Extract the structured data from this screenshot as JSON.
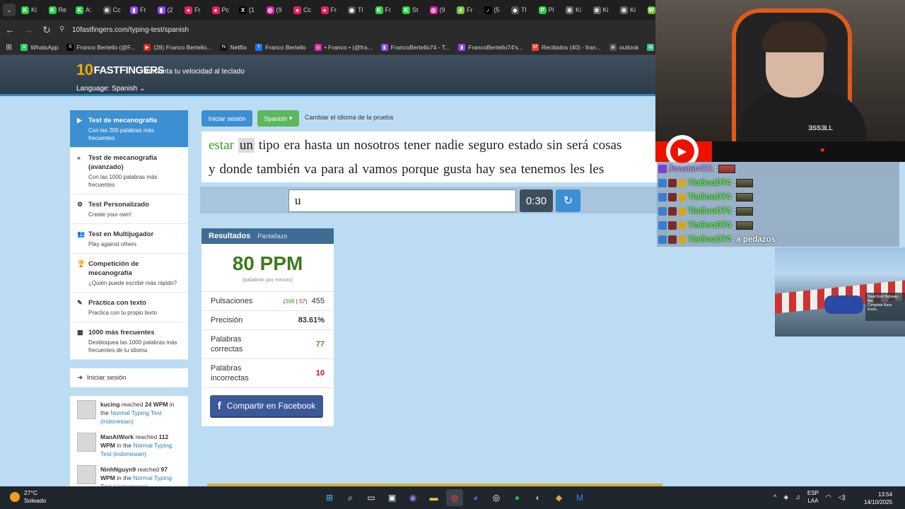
{
  "browser": {
    "tabs": [
      {
        "label": "Ki",
        "color": "#2ecc40",
        "glyph": "K"
      },
      {
        "label": "Re",
        "color": "#2ecc40",
        "glyph": "K"
      },
      {
        "label": "A:",
        "color": "#2ecc40",
        "glyph": "K"
      },
      {
        "label": "Cc",
        "color": "#555555",
        "glyph": "⊗"
      },
      {
        "label": "Fr",
        "color": "#9146ff",
        "glyph": "▮"
      },
      {
        "label": "(2",
        "color": "#9146ff",
        "glyph": "▮"
      },
      {
        "label": "Fr",
        "color": "#e91e63",
        "glyph": "●"
      },
      {
        "label": "Pc",
        "color": "#e91e63",
        "glyph": "●"
      },
      {
        "label": "(1",
        "color": "#000000",
        "glyph": "X"
      },
      {
        "label": "(9",
        "color": "#d6249f",
        "glyph": "◎"
      },
      {
        "label": "Cc",
        "color": "#e91e63",
        "glyph": "●"
      },
      {
        "label": "Fr",
        "color": "#e91e63",
        "glyph": "●"
      },
      {
        "label": "Tl",
        "color": "#555555",
        "glyph": "◉"
      },
      {
        "label": "Fr",
        "color": "#2ecc40",
        "glyph": "K"
      },
      {
        "label": "St",
        "color": "#2ecc40",
        "glyph": "K"
      },
      {
        "label": "(9",
        "color": "#d6249f",
        "glyph": "◎"
      },
      {
        "label": "Fr",
        "color": "#7cc242",
        "glyph": "#"
      },
      {
        "label": "(5",
        "color": "#000000",
        "glyph": "♪"
      },
      {
        "label": "Tl",
        "color": "#555555",
        "glyph": "◆"
      },
      {
        "label": "Pl",
        "color": "#2ecc40",
        "glyph": "P"
      },
      {
        "label": "Ki",
        "color": "#666666",
        "glyph": "⊗"
      },
      {
        "label": "Ki",
        "color": "#666666",
        "glyph": "⊗"
      },
      {
        "label": "Ki",
        "color": "#666666",
        "glyph": "⊗"
      },
      {
        "label": "Ki",
        "color": "#6fbf3a",
        "glyph": "W"
      }
    ],
    "url": "10fastfingers.com/typing-test/spanish",
    "bookmarks": [
      {
        "label": "WhatsApp",
        "color": "#25d366",
        "glyph": "●"
      },
      {
        "label": "Franco Bertello (@F...",
        "color": "#000000",
        "glyph": "X"
      },
      {
        "label": "(28) Franco Bertello...",
        "color": "#e62117",
        "glyph": "▶"
      },
      {
        "label": "Netflix",
        "color": "#111111",
        "glyph": "N"
      },
      {
        "label": "Franco Bertello",
        "color": "#1877f2",
        "glyph": "f"
      },
      {
        "label": "• Franco • (@fra...",
        "color": "#d6249f",
        "glyph": "◎"
      },
      {
        "label": "FrancoBertello74 - T...",
        "color": "#9146ff",
        "glyph": "▮"
      },
      {
        "label": "FrancoBertello74's...",
        "color": "#9146ff",
        "glyph": "▮"
      },
      {
        "label": "Recibidos (40) - fran...",
        "color": "#ea4335",
        "glyph": "M"
      },
      {
        "label": "outlook",
        "color": "#555555",
        "glyph": "⊕"
      },
      {
        "label": "Aler",
        "color": "#3bbf8a",
        "glyph": "✉"
      }
    ]
  },
  "site": {
    "logo_ten": "10",
    "logo_text": "FASTFINGERS",
    "tagline": "Aumenta tu velocidad al teclado",
    "language_selector": "Language: Spanish"
  },
  "sidebar": {
    "items": [
      {
        "title": "Test de mecanografía",
        "subtitle": "Con las 200 palabras más frecuentes",
        "icon": "▶"
      },
      {
        "title": "Test de mecanografía (avanzado)",
        "subtitle": "Con las 1000 palabras más frecuentes",
        "icon": "»"
      },
      {
        "title": "Test Personalizado",
        "subtitle": "Create your own!",
        "icon": "⚙"
      },
      {
        "title": "Test en Multijugador",
        "subtitle": "Play against others",
        "icon": "👥"
      },
      {
        "title": "Competición de mecanografía",
        "subtitle": "¿Quién puede escribir más rápido?",
        "icon": "🏆"
      },
      {
        "title": "Práctica con texto",
        "subtitle": "Practica con tu propio texto",
        "icon": "✎"
      },
      {
        "title": "1000 más frecuentes",
        "subtitle": "Desbloquea las 1000 palabras más frecuentes de tu idioma",
        "icon": "▦"
      }
    ],
    "login": "Iniciar sesión",
    "activity": [
      {
        "user": "kucing",
        "reached": "reached",
        "wpm": "24 WPM",
        "in_the": "in the",
        "test": "Normal Typing Test (indonesian)"
      },
      {
        "user": "ManAtWork",
        "reached": "reached",
        "wpm": "112 WPM",
        "in_the": "in the",
        "test": "Normal Typing Test (indonesian)"
      },
      {
        "user": "NinhNguyn9",
        "reached": "reached",
        "wpm": "97 WPM",
        "in_the": "in the",
        "test": "Normal Typing Test (vietnamese)"
      }
    ]
  },
  "toolbar": {
    "login_button": "Iniciar sesión",
    "lang_button": "Spanish",
    "change_lang": "Cambiar el idioma de la prueba"
  },
  "test": {
    "line1": [
      "estar",
      "un",
      "tipo",
      "era",
      "hasta",
      "un",
      "nosotros",
      "tener",
      "nadie",
      "seguro",
      "estado",
      "sin",
      "será",
      "cosas"
    ],
    "line2": [
      "y",
      "donde",
      "también",
      "va",
      "para",
      "al",
      "vamos",
      "porque",
      "gusta",
      "hay",
      "sea",
      "tenemos",
      "les",
      "les"
    ],
    "input_value": "u",
    "timer": "0:30",
    "reload_icon": "↻"
  },
  "results": {
    "title": "Resultados",
    "screenshot": "Pantallazo",
    "wpm": "80 PPM",
    "wpm_caption": "(palabras por minuto)",
    "keystrokes_label": "Pulsaciones",
    "keystrokes_open": "(",
    "keystrokes_correct": "398",
    "keystrokes_sep": "|",
    "keystrokes_wrong": "57",
    "keystrokes_close": ")",
    "keystrokes_total": "455",
    "accuracy_label": "Precisión",
    "accuracy": "83.61%",
    "correct_label": "Palabras correctas",
    "correct": "77",
    "wrong_label": "Palabras incorrectas",
    "wrong": "10",
    "facebook_button": "Compartir en Facebook"
  },
  "stream": {
    "shirt_logo": "ƎSSƎLL",
    "chat": [
      {
        "name": "Jonatan421",
        "text": "",
        "emote": "red",
        "first": true
      },
      {
        "name": "TiaGooD74",
        "text": "",
        "emote": "olive"
      },
      {
        "name": "TiaGooD74",
        "text": "",
        "emote": "olive"
      },
      {
        "name": "TiaGooD74",
        "text": "",
        "emote": "olive"
      },
      {
        "name": "TiaGooD74",
        "text": "",
        "emote": "olive"
      },
      {
        "name": "TiaGooD74",
        "text": "a pedazos",
        "emote": ""
      }
    ],
    "game_panel_title": "Dead End Highway - Ma",
    "game_panel_sub": "Complete Race Evolv..."
  },
  "taskbar": {
    "temp": "27°C",
    "weather": "Soleado",
    "lang_top": "ESP",
    "lang_bottom": "LAA",
    "time": "13:54",
    "date": "14/10/2025"
  }
}
